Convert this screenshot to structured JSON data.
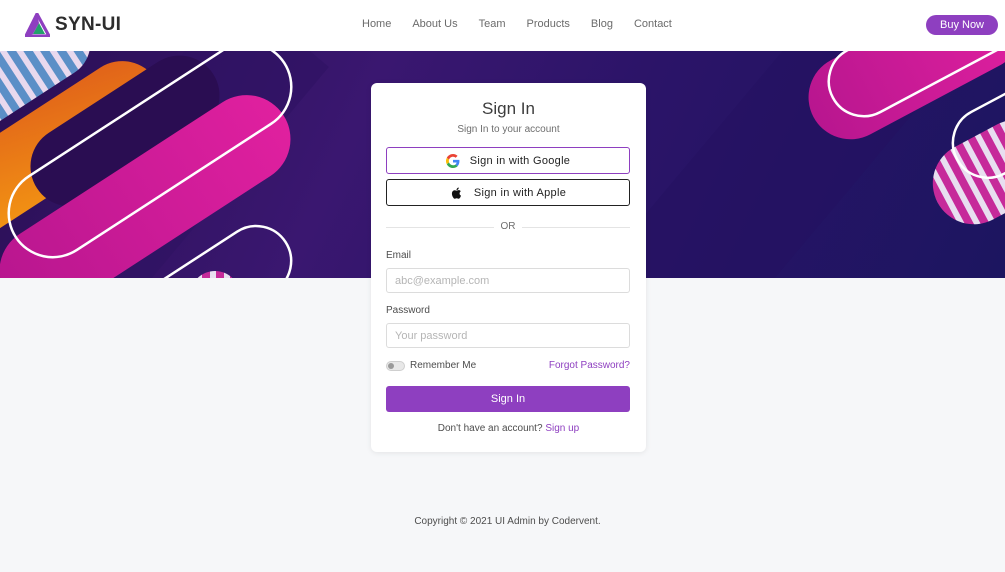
{
  "brand": {
    "name": "SYN-UI",
    "logo_icon": "triangle-logo-icon"
  },
  "nav": {
    "links": [
      "Home",
      "About Us",
      "Team",
      "Products",
      "Blog",
      "Contact"
    ],
    "buy_label": "Buy Now"
  },
  "card": {
    "title": "Sign In",
    "subtitle": "Sign In to your account",
    "google_label": "Sign in with Google",
    "apple_label": "Sign in with Apple",
    "divider_text": "OR",
    "email_label": "Email",
    "email_placeholder": "abc@example.com",
    "email_value": "",
    "password_label": "Password",
    "password_placeholder": "Your password",
    "password_value": "",
    "remember_label": "Remember Me",
    "remember_checked": false,
    "forgot_label": "Forgot Password?",
    "submit_label": "Sign In",
    "signup_prompt": "Don't have an account?",
    "signup_link": "Sign up"
  },
  "footer": {
    "copyright": "Copyright © 2021 UI Admin by Codervent."
  },
  "colors": {
    "accent": "#8e3fc0",
    "hero_bg": "#2a0f55",
    "hero_pink": "#d41ca0",
    "hero_orange": "#f08a12",
    "page_bg": "#f6f7f9"
  }
}
